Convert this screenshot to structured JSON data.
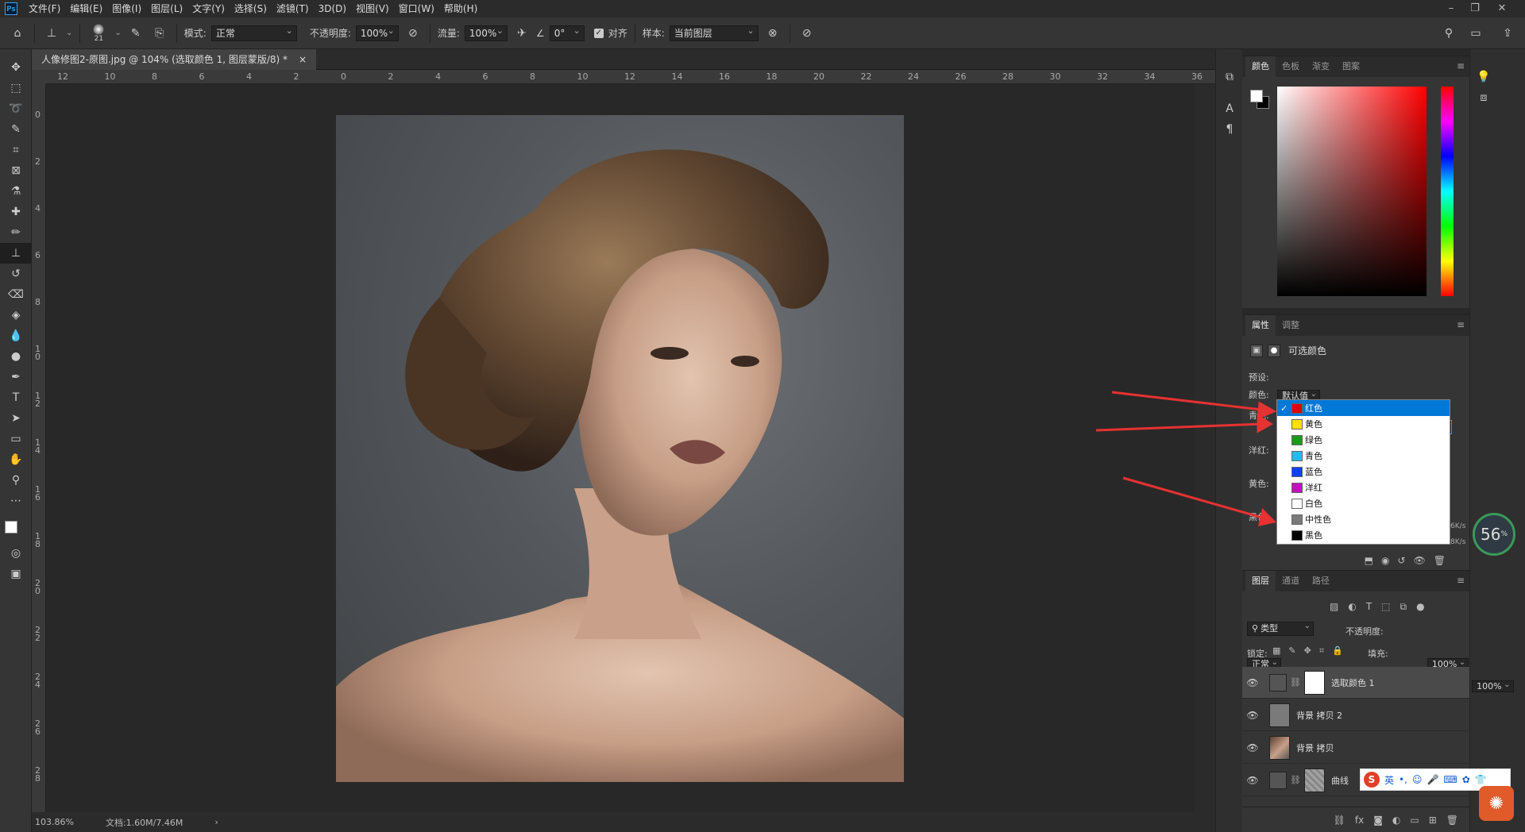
{
  "menubar": {
    "logo": "Ps",
    "items": [
      "文件(F)",
      "编辑(E)",
      "图像(I)",
      "图层(L)",
      "文字(Y)",
      "选择(S)",
      "滤镜(T)",
      "3D(D)",
      "视图(V)",
      "窗口(W)",
      "帮助(H)"
    ]
  },
  "options": {
    "brush_size": "21",
    "mode_label": "模式:",
    "mode_value": "正常",
    "opacity_label": "不透明度:",
    "opacity_value": "100%",
    "flow_label": "流量:",
    "flow_value": "100%",
    "angle_value": "0°",
    "align_label": "对齐",
    "sample_label": "样本:",
    "sample_value": "当前图层"
  },
  "document": {
    "tab_title": "人像修图2-原图.jpg @ 104% (选取颜色 1, 图层蒙版/8) *",
    "close": "×",
    "ruler_h": [
      "12",
      "10",
      "8",
      "6",
      "4",
      "2",
      "0",
      "2",
      "4",
      "6",
      "8",
      "10",
      "12",
      "14",
      "16",
      "18",
      "20",
      "22",
      "24",
      "26",
      "28",
      "30",
      "32",
      "34",
      "36"
    ],
    "ruler_v": [
      "0",
      "2",
      "4",
      "6",
      "8",
      "1\n0",
      "1\n2",
      "1\n4",
      "1\n6",
      "1\n8",
      "2\n0",
      "2\n2",
      "2\n4",
      "2\n6",
      "2\n8"
    ]
  },
  "status": {
    "zoom": "103.86%",
    "doc_info": "文档:1.60M/7.46M",
    "arrow": "›"
  },
  "color_panel": {
    "tabs": [
      "颜色",
      "色板",
      "渐变",
      "图案"
    ]
  },
  "properties": {
    "tabs": [
      "属性",
      "调整"
    ],
    "title": "可选颜色",
    "preset_label": "预设:",
    "preset_value": "默认值",
    "colors_label": "颜色:",
    "colors_value": "红色",
    "cyan_label": "青色:",
    "magenta_label": "洋红:",
    "yellow_label": "黄色:",
    "black_label": "黑色:",
    "color_options": [
      {
        "label": "红色",
        "color": "#e00000"
      },
      {
        "label": "黄色",
        "color": "#ffe000"
      },
      {
        "label": "绿色",
        "color": "#1a9a1a"
      },
      {
        "label": "青色",
        "color": "#28b8f0"
      },
      {
        "label": "蓝色",
        "color": "#1040f0"
      },
      {
        "label": "洋红",
        "color": "#c010c0"
      },
      {
        "label": "白色",
        "color": "#ffffff"
      },
      {
        "label": "中性色",
        "color": "#7a7a7a"
      },
      {
        "label": "黑色",
        "color": "#000000"
      }
    ],
    "net_speed_up": "6K/s",
    "net_speed_down": "8K/s",
    "net_percent": "56",
    "net_percent_sign": "%"
  },
  "layers_panel": {
    "tabs": [
      "图层",
      "通道",
      "路径"
    ],
    "kind_label": "类型",
    "blend_mode": "正常",
    "opacity_label": "不透明度:",
    "opacity_value": "100%",
    "lock_label": "锁定:",
    "fill_label": "填充:",
    "fill_value": "100%",
    "layers": [
      {
        "name": "选取颜色 1"
      },
      {
        "name": "背景 拷贝 2"
      },
      {
        "name": "背景 拷贝"
      },
      {
        "name": "曲线"
      }
    ]
  },
  "ime": {
    "label": "英"
  },
  "colors": {
    "accent": "#0078d7",
    "arrow": "#e63232"
  }
}
